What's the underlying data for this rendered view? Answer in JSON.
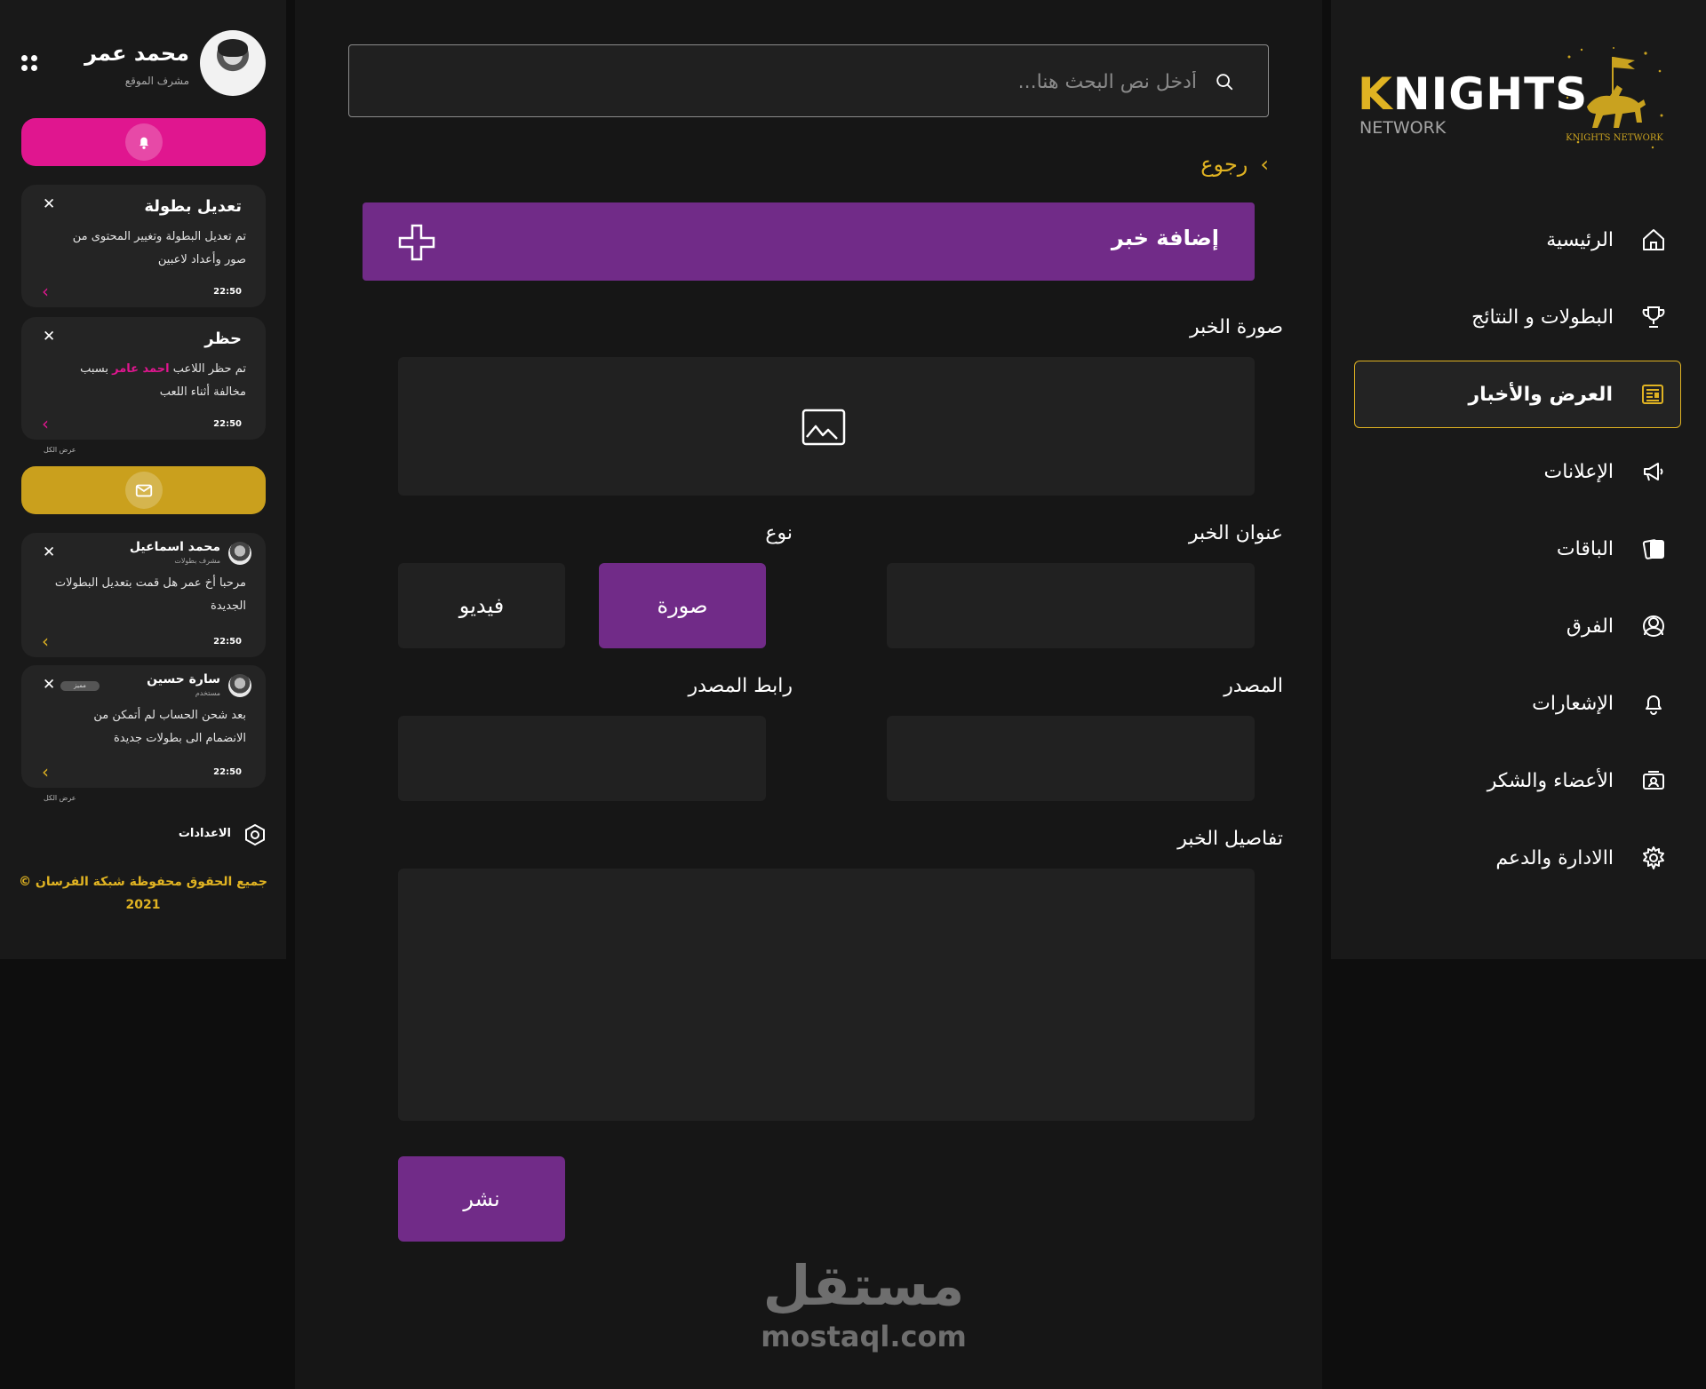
{
  "profile": {
    "name": "محمد عمر",
    "role": "مشرف الموقع"
  },
  "notifications": [
    {
      "title": "تعديل بطولة",
      "body": "تم تعديل البطولة وتغيير المحتوى من صور وأعداد لاعبين",
      "time": "22:50"
    },
    {
      "title": "حظر",
      "body_pre": "تم حظر اللاعب ",
      "body_highlight": "احمد عامر",
      "body_post": " بسبب مخالفة أثناء اللعب",
      "time": "22:50"
    }
  ],
  "messages": [
    {
      "name": "محمد اسماعيل",
      "role": "مشرف بطولات",
      "body": "مرحبا أخ عمر هل قمت بتعديل البطولات الجديدة",
      "time": "22:50"
    },
    {
      "name": "سارة حسين",
      "role": "مستخدم",
      "badge": "مميز",
      "body": "بعد شحن الحساب لم أتمكن من الانضمام الى بطولات جديدة",
      "time": "22:50"
    }
  ],
  "show_all_label": "عرض الكل",
  "settings_label": "الاعدادات",
  "copyright": "جميع الحقوق محفوظة شبكة الفرسان © 2021",
  "search": {
    "placeholder": "أدخل نص البحث هنا..."
  },
  "back_label": "رجوع",
  "form": {
    "header": "إضافة خبر",
    "image_label": "صورة الخبر",
    "title_label": "عنوان الخبر",
    "type_label": "نوع",
    "type_options": [
      "صورة",
      "فيديو"
    ],
    "type_selected": "صورة",
    "source_label": "المصدر",
    "source_link_label": "رابط المصدر",
    "details_label": "تفاصيل الخبر",
    "submit_label": "نشر"
  },
  "watermark": {
    "arabic": "مستقل",
    "latin": "mostaql.com"
  },
  "brand": {
    "first_letter": "K",
    "rest": "NIGHTS",
    "subtitle": "NETWORK",
    "logo_text": "KNIGHTS NETWORK"
  },
  "nav": [
    {
      "label": "الرئيسية",
      "icon": "home-icon"
    },
    {
      "label": "البطولات و النتائج",
      "icon": "trophy-icon"
    },
    {
      "label": "العرض والأخبار",
      "icon": "news-icon",
      "active": true
    },
    {
      "label": "الإعلانات",
      "icon": "megaphone-icon"
    },
    {
      "label": "الباقات",
      "icon": "cards-icon"
    },
    {
      "label": "الفرق",
      "icon": "team-icon"
    },
    {
      "label": "الإشعارات",
      "icon": "bell-icon"
    },
    {
      "label": "الأعضاء والشكر",
      "icon": "members-icon"
    },
    {
      "label": "االادارة والدعم",
      "icon": "gear-icon"
    }
  ],
  "colors": {
    "accent_purple": "#712b88",
    "accent_gold": "#e0b322",
    "accent_pink": "#e0168f",
    "background": "#161616"
  }
}
